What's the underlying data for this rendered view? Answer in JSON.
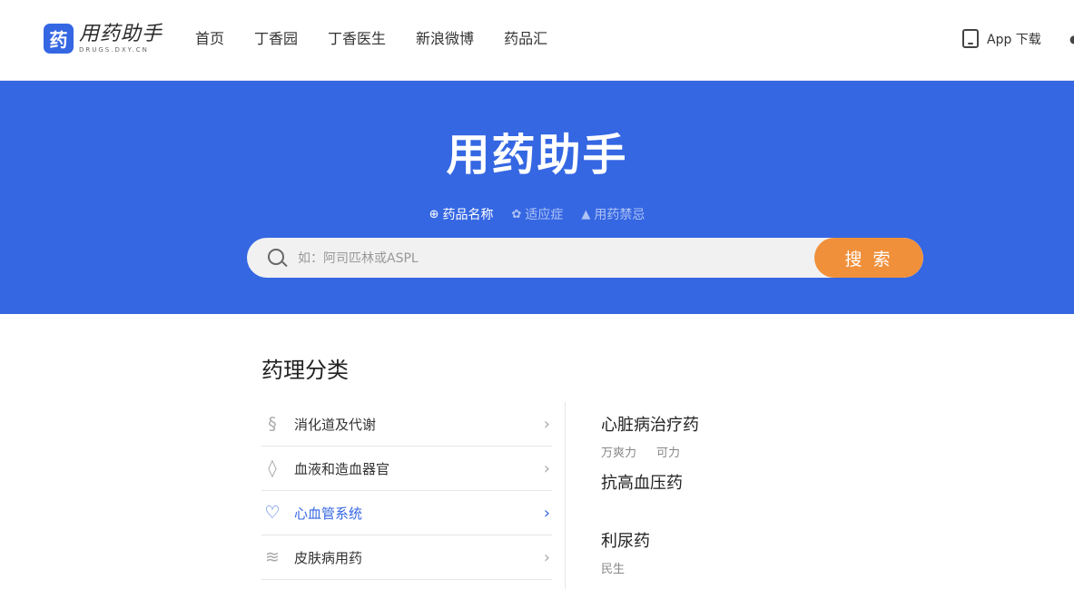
{
  "header": {
    "logo_char": "药",
    "logo_title": "用药助手",
    "logo_sub": "DRUGS.DXY.CN",
    "nav": [
      "首页",
      "丁香园",
      "丁香医生",
      "新浪微博",
      "药品汇"
    ],
    "app_download": "App 下载"
  },
  "hero": {
    "title": "用药助手",
    "tabs": [
      {
        "label": "药品名称",
        "icon": "medicine-bottle-icon",
        "active": true
      },
      {
        "label": "适应症",
        "icon": "virus-icon",
        "active": false
      },
      {
        "label": "用药禁忌",
        "icon": "warning-icon",
        "active": false
      }
    ],
    "search_placeholder": "如：阿司匹林或ASPL",
    "search_button": "搜 索"
  },
  "section": {
    "title": "药理分类",
    "categories": [
      {
        "label": "消化道及代谢",
        "icon": "stomach-icon"
      },
      {
        "label": "血液和造血器官",
        "icon": "blood-drop-icon"
      },
      {
        "label": "心血管系统",
        "icon": "heart-icon",
        "active": true
      },
      {
        "label": "皮肤病用药",
        "icon": "skin-icon"
      }
    ],
    "subcategories": [
      {
        "title": "心脏病治疗药",
        "items": [
          "万爽力",
          "可力"
        ]
      },
      {
        "title": "抗高血压药",
        "items": []
      },
      {
        "title": "利尿药",
        "items": [
          "民生"
        ]
      }
    ]
  },
  "colors": {
    "brand": "#3567e3",
    "search_button": "#f0903b"
  }
}
